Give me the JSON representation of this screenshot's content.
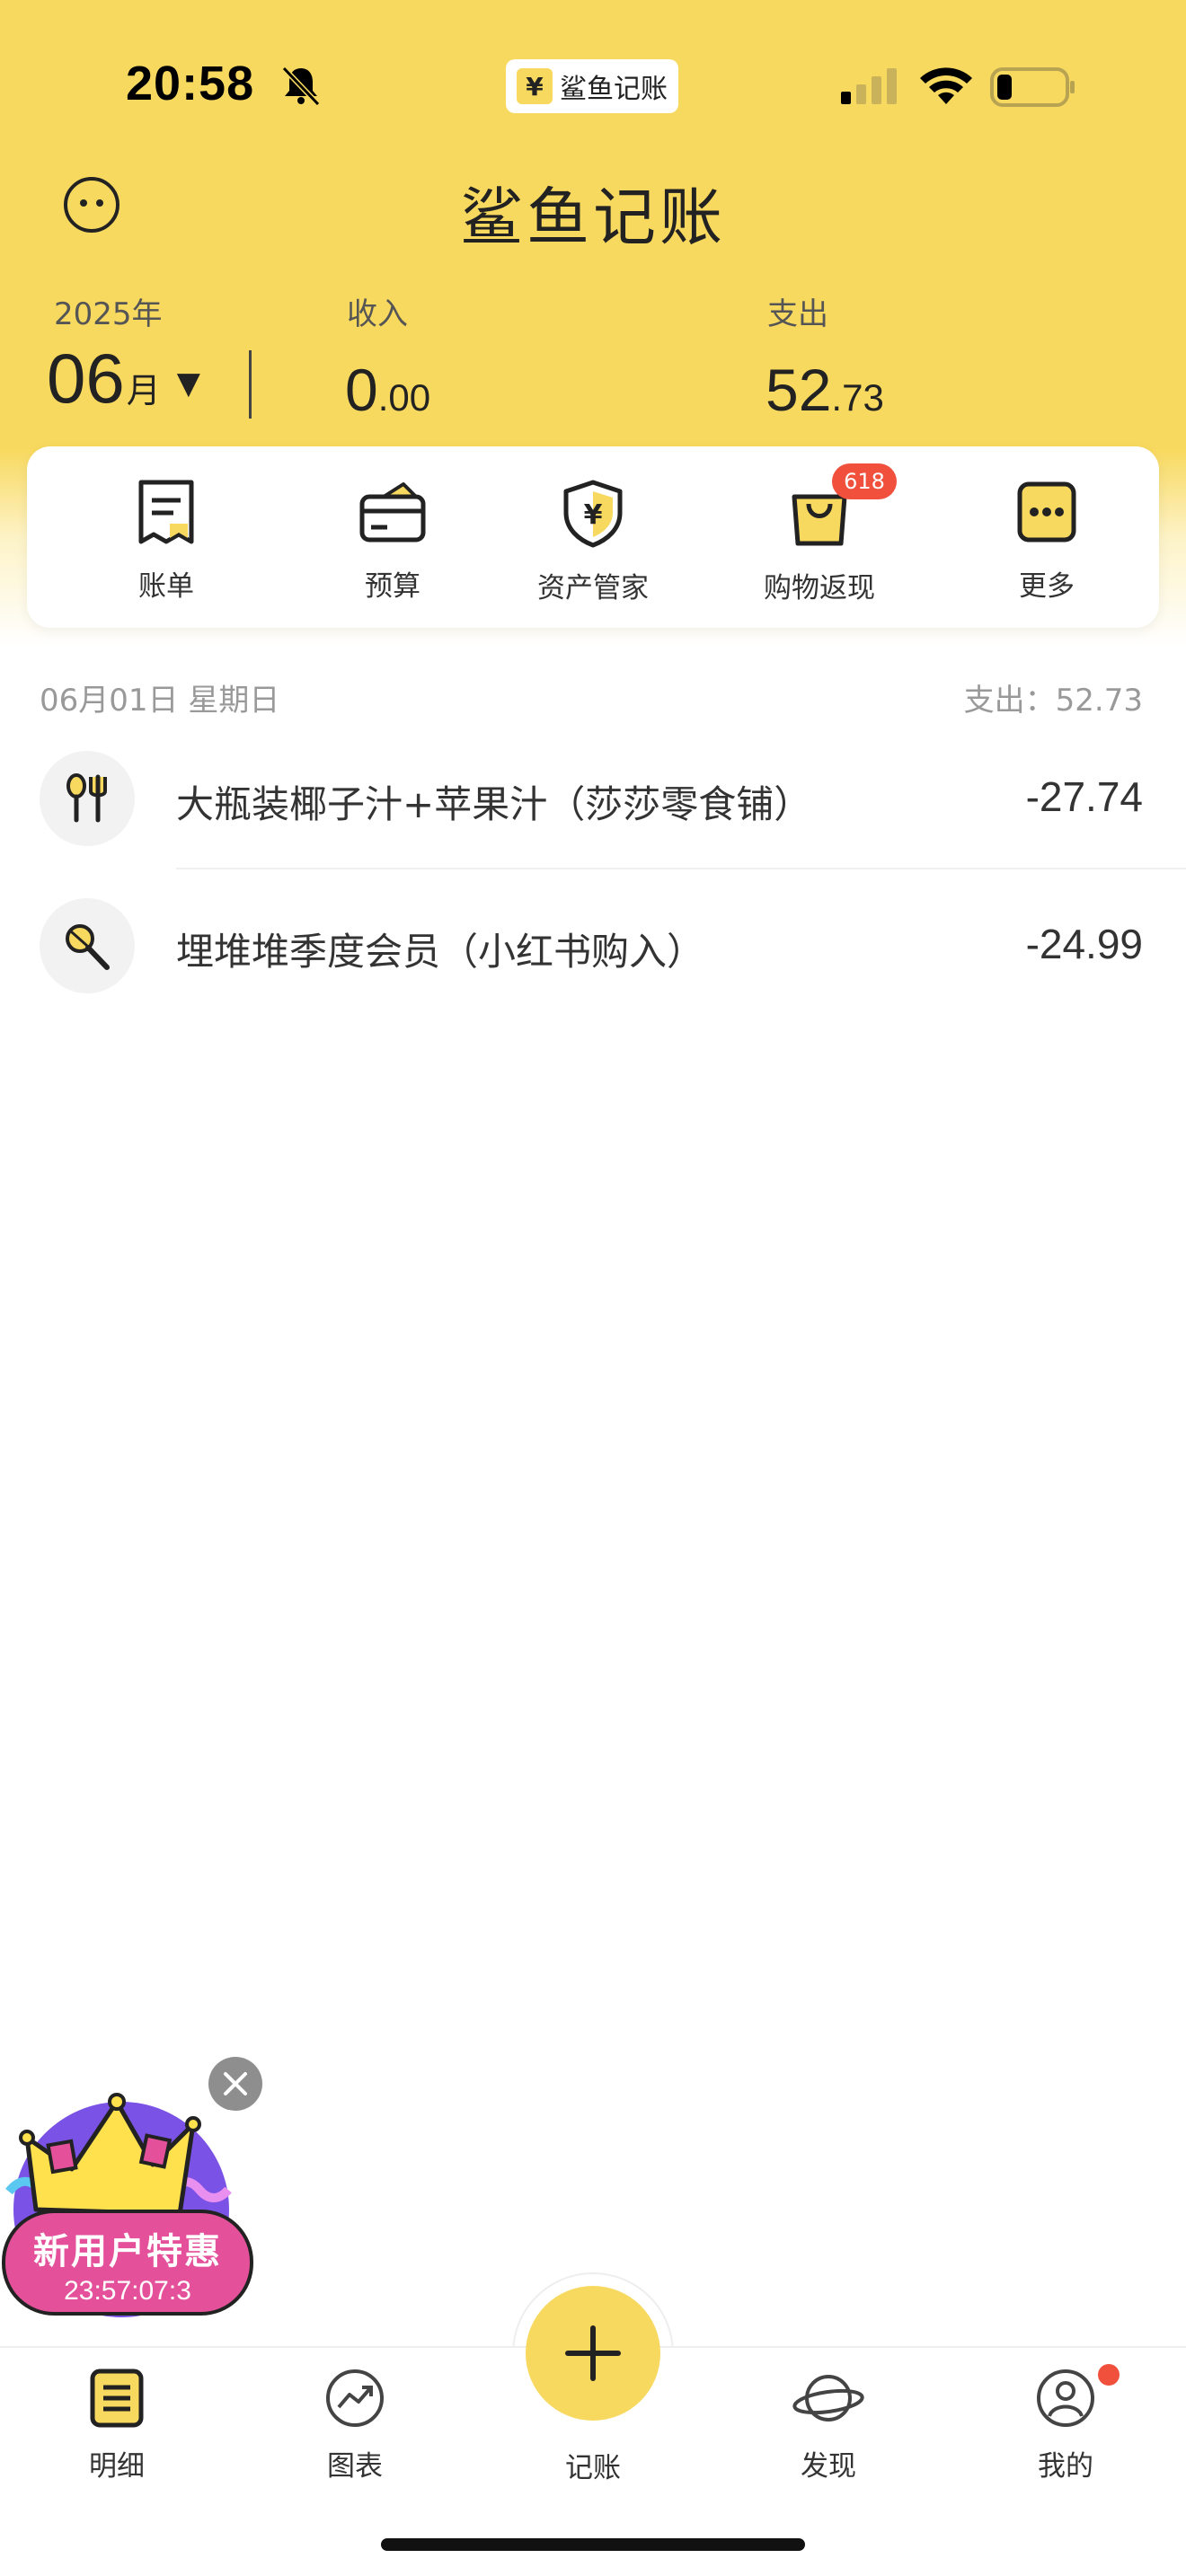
{
  "status_bar": {
    "time": "20:58",
    "app_pill_icon": "¥",
    "app_pill_text": "鲨鱼记账"
  },
  "header": {
    "title": "鲨鱼记账",
    "year": "2025年",
    "month_num": "06",
    "month_unit": "月",
    "dropdown_icon": "▼",
    "income_label": "收入",
    "income_int": "0",
    "income_dec": ".00",
    "expense_label": "支出",
    "expense_int": "52",
    "expense_dec": ".73"
  },
  "shortcuts": [
    {
      "label": "账单",
      "icon": "bill-icon"
    },
    {
      "label": "预算",
      "icon": "budget-wallet-icon"
    },
    {
      "label": "资产管家",
      "icon": "asset-shield-icon"
    },
    {
      "label": "购物返现",
      "icon": "shopping-bag-icon",
      "badge": "618"
    },
    {
      "label": "更多",
      "icon": "more-icon"
    }
  ],
  "day_group": {
    "date": "06月01日  星期日",
    "total": "支出：52.73"
  },
  "transactions": [
    {
      "icon": "dining-icon",
      "description": "大瓶装椰子汁+苹果汁（莎莎零食铺）",
      "amount": "-27.74"
    },
    {
      "icon": "entertainment-mic-icon",
      "description": "埋堆堆季度会员（小红书购入）",
      "amount": "-24.99"
    }
  ],
  "promo": {
    "title": "新用户特惠",
    "countdown": "23:57:07:3"
  },
  "bottom_nav": {
    "items": [
      {
        "label": "明细",
        "icon": "detail-list-icon"
      },
      {
        "label": "图表",
        "icon": "chart-icon"
      },
      {
        "label": "记账",
        "icon": "plus-icon"
      },
      {
        "label": "发现",
        "icon": "planet-icon"
      },
      {
        "label": "我的",
        "icon": "profile-icon"
      }
    ]
  },
  "colors": {
    "brand_yellow": "#f8d95f",
    "badge_red": "#f0503c",
    "promo_pink": "#e4519a"
  }
}
